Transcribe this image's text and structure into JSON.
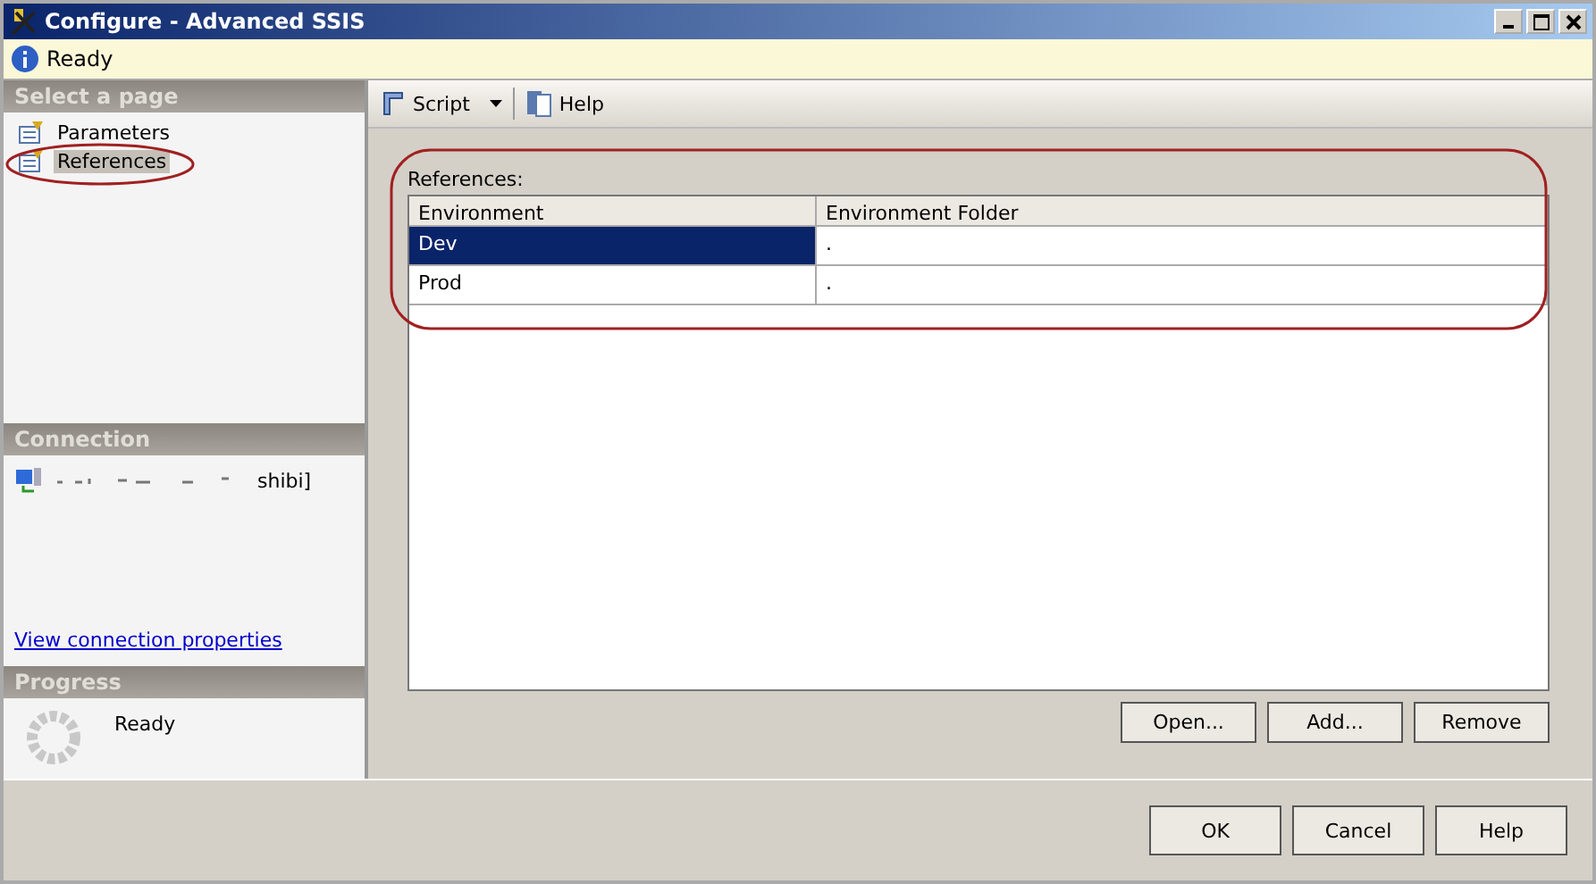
{
  "window": {
    "title": "Configure - Advanced SSIS"
  },
  "status": {
    "text": "Ready"
  },
  "sidebar": {
    "header": "Select a page",
    "items": [
      {
        "label": "Parameters",
        "selected": false
      },
      {
        "label": "References",
        "selected": true
      }
    ]
  },
  "connection": {
    "header": "Connection",
    "server": "shibi]",
    "link": "View connection properties"
  },
  "progress": {
    "header": "Progress",
    "text": "Ready"
  },
  "toolbar": {
    "script": "Script",
    "help": "Help"
  },
  "references": {
    "label": "References:",
    "columns": [
      "Environment",
      "Environment Folder"
    ],
    "rows": [
      {
        "cells": [
          "Dev",
          "."
        ],
        "selected": true
      },
      {
        "cells": [
          "Prod",
          "."
        ],
        "selected": false
      }
    ]
  },
  "list_buttons": [
    "Open...",
    "Add...",
    "Remove"
  ],
  "dialog_buttons": [
    "OK",
    "Cancel",
    "Help"
  ]
}
